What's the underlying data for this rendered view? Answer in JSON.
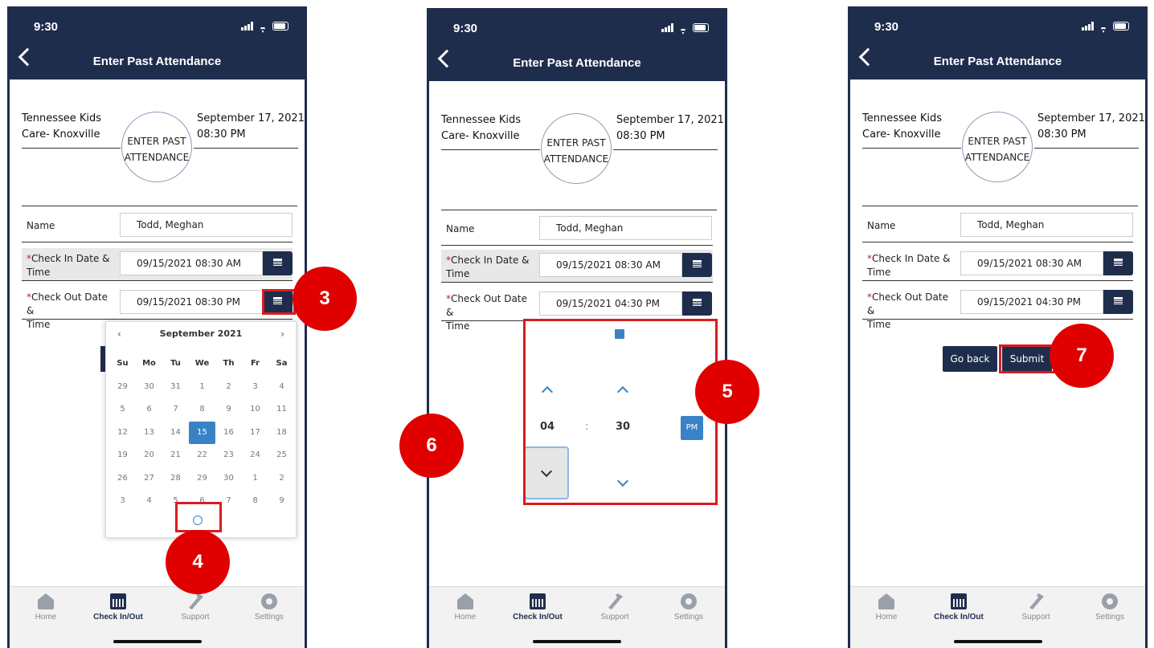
{
  "status": {
    "time": "9:30"
  },
  "header": {
    "title": "Enter Past Attendance"
  },
  "center": {
    "name": "Tennessee Kids",
    "name2": "Care- Knoxville",
    "date": "September 17, 2021",
    "time": "08:30 PM"
  },
  "logo": {
    "line1": "ENTER PAST",
    "line2": "ATTENDANCE"
  },
  "form": {
    "name_label": "Name",
    "name_value": "Todd, Meghan",
    "required_mark": "*",
    "checkin_label": "Check In Date &",
    "checkin_label2": "Time",
    "checkout_label": "Check Out Date &",
    "checkout_label2": "Time",
    "checkin_value": "09/15/2021 08:30 AM",
    "checkout_value_before": "09/15/2021 08:30 PM",
    "checkout_value_after": "09/15/2021 04:30 PM"
  },
  "calendar": {
    "month": "September 2021",
    "prev": "‹",
    "next": "›",
    "dow": [
      "Su",
      "Mo",
      "Tu",
      "We",
      "Th",
      "Fr",
      "Sa"
    ],
    "days": [
      "29",
      "30",
      "31",
      "1",
      "2",
      "3",
      "4",
      "5",
      "6",
      "7",
      "8",
      "9",
      "10",
      "11",
      "12",
      "13",
      "14",
      "15",
      "16",
      "17",
      "18",
      "19",
      "20",
      "21",
      "22",
      "23",
      "24",
      "25",
      "26",
      "27",
      "28",
      "29",
      "30",
      "1",
      "2",
      "3",
      "4",
      "5",
      "6",
      "7",
      "8",
      "9"
    ],
    "selected": "15"
  },
  "timepicker": {
    "hour": "04",
    "sep": ":",
    "minute": "30",
    "ampm": "PM"
  },
  "buttons": {
    "go_back": "Go back",
    "submit": "Submit"
  },
  "nav": {
    "home": "Home",
    "checkin": "Check In/Out",
    "support": "Support",
    "settings": "Settings"
  },
  "callouts": {
    "c3": "3",
    "c4": "4",
    "c5": "5",
    "c6": "6",
    "c7": "7"
  },
  "colors": {
    "navy": "#1f2d4d",
    "accent": "#3a82c6",
    "callout": "#e00000"
  }
}
